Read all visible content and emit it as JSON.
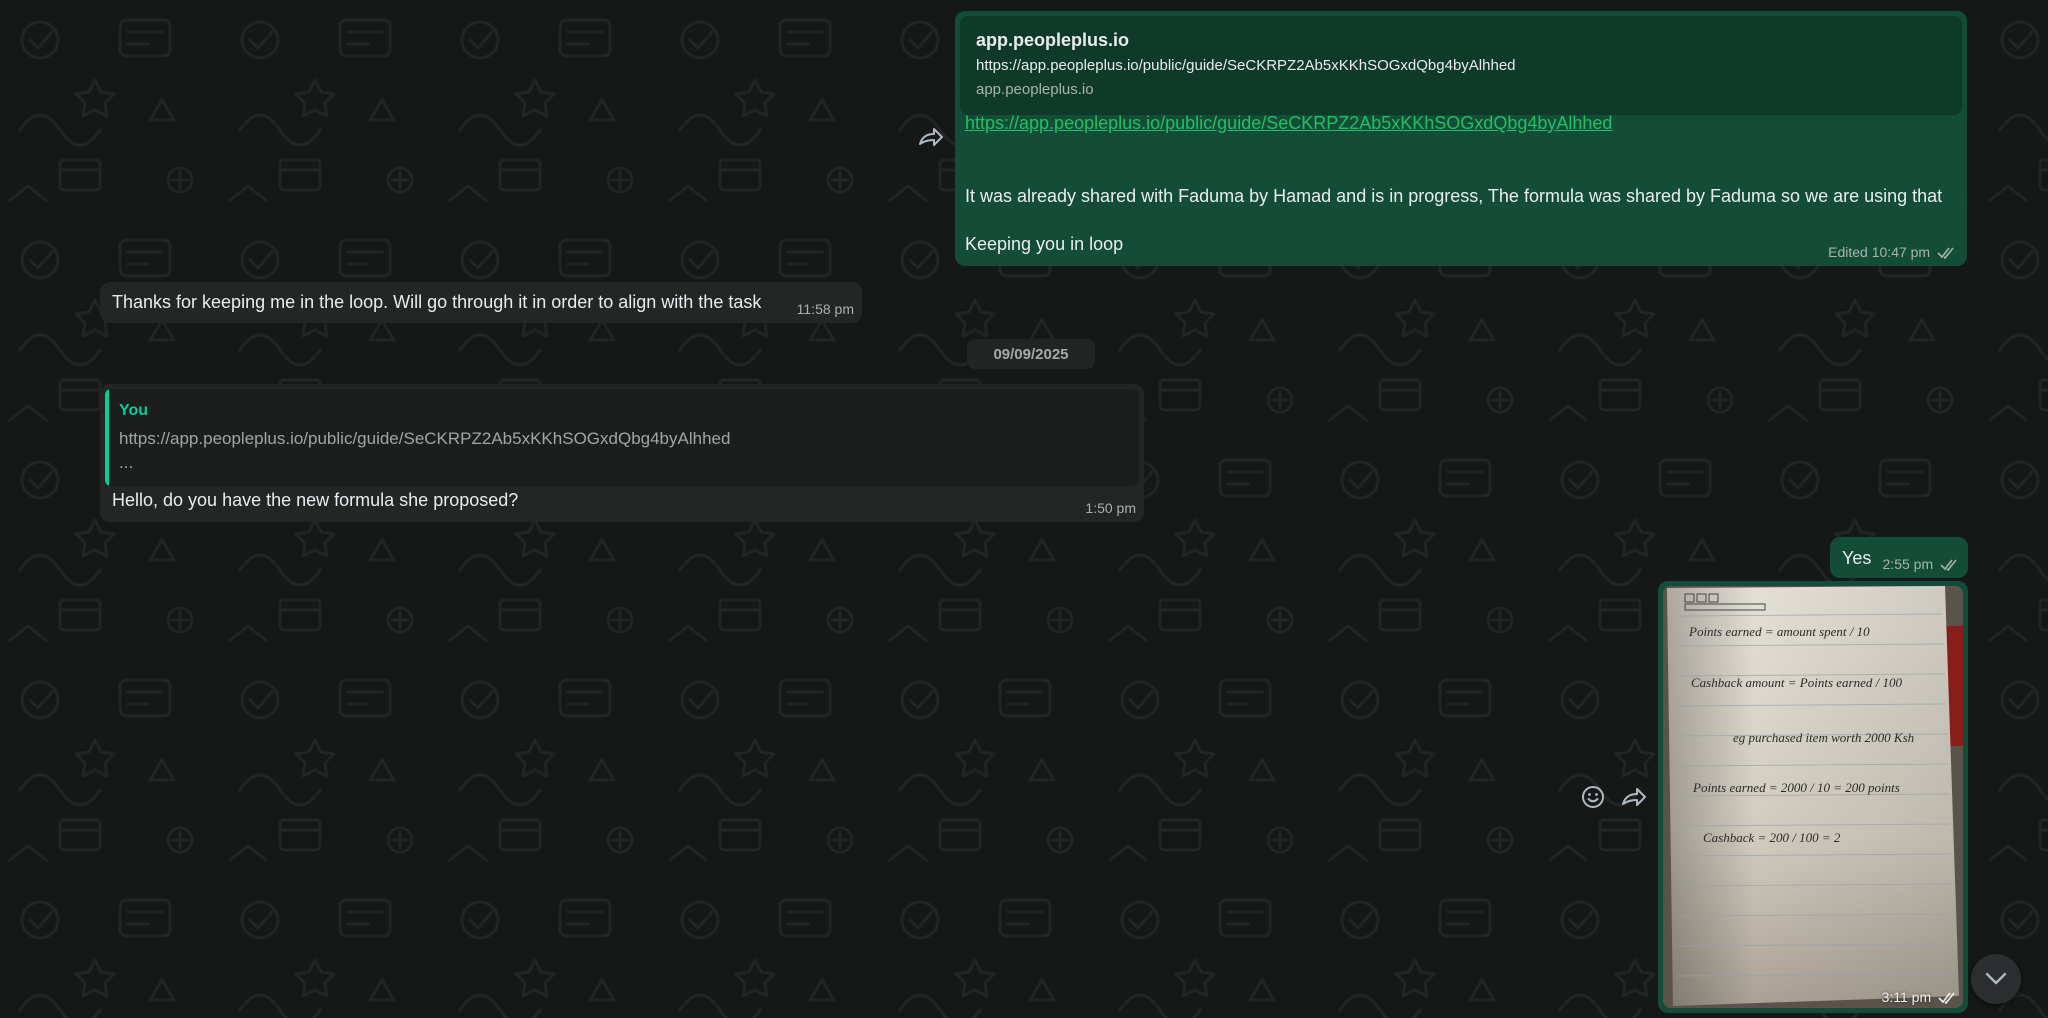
{
  "colors": {
    "background": "#161717",
    "outgoing_bubble": "#144d37",
    "incoming_bubble": "#242626",
    "link": "#21c063",
    "quote_accent": "#06cf9c"
  },
  "messages": [
    {
      "direction": "outgoing",
      "preview": {
        "title": "app.peopleplus.io",
        "url": "https://app.peopleplus.io/public/guide/SeCKRPZ2Ab5xKKhSOGxdQbg4byAlhhed",
        "domain": "app.peopleplus.io"
      },
      "link": "https://app.peopleplus.io/public/guide/SeCKRPZ2Ab5xKKhSOGxdQbg4byAlhhed",
      "text_lines": [
        "It was already shared with Faduma by Hamad and is in progress, The formula was shared by Faduma so we are using that",
        "Keeping you in loop"
      ],
      "meta": "Edited 10:47 pm",
      "status_icon": "double-check-icon"
    },
    {
      "direction": "incoming",
      "text": "Thanks for keeping me in the loop. Will go through it in order to align with the task",
      "time": "11:58 pm"
    },
    {
      "direction": "incoming",
      "quote": {
        "author": "You",
        "text": "https://app.peopleplus.io/public/guide/SeCKRPZ2Ab5xKKhSOGxdQbg4byAlhhed",
        "more": "..."
      },
      "text": "Hello, do you have the new formula she proposed?",
      "time": "1:50 pm"
    },
    {
      "direction": "outgoing",
      "text": "Yes",
      "time": "2:55 pm",
      "status_icon": "double-check-icon"
    },
    {
      "direction": "outgoing",
      "type": "image",
      "image_lines": [
        "Points earned = amount spent / 10",
        "Cashback amount = Points earned / 100",
        "eg purchased item worth 2000 Ksh",
        "Points earned = 2000 / 10 = 200 points",
        "Cashback = 200 / 100 = 2"
      ],
      "time": "3:11 pm",
      "status_icon": "double-check-icon"
    }
  ],
  "date_separator": "09/09/2025",
  "icons": {
    "forward": "forward-icon",
    "emoji": "emoji-icon",
    "scroll_down": "chevron-down-icon"
  }
}
